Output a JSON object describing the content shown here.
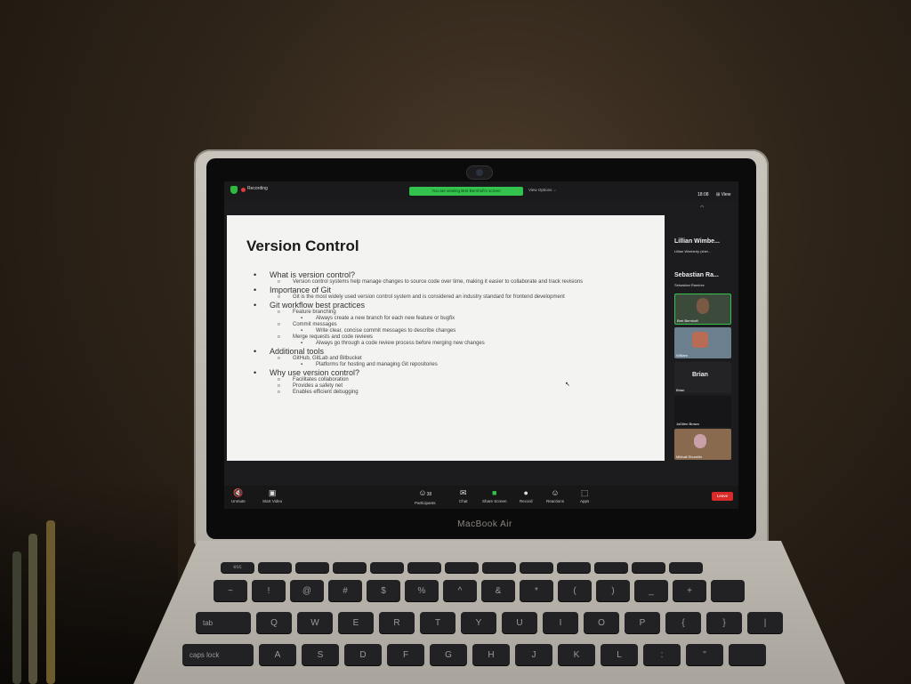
{
  "zoom": {
    "topbar": {
      "recording_label": "Recording",
      "viewing_banner": "You are viewing Bret Bernhoft's screen",
      "view_options": "View Options ⌵",
      "clock": "18:08",
      "view_button": "⊞ View"
    },
    "slide": {
      "title": "Version Control",
      "items": [
        {
          "level": 1,
          "text": "What is version control?"
        },
        {
          "level": 2,
          "text": "Version control systems help manage changes to source code over time, making it easier to collaborate and track revisions"
        },
        {
          "level": 1,
          "text": "Importance of Git"
        },
        {
          "level": 2,
          "text": "Git is the most widely used version control system and is considered an industry standard for frontend development"
        },
        {
          "level": 1,
          "text": "Git workflow best practices"
        },
        {
          "level": 2,
          "text": "Feature branching"
        },
        {
          "level": 3,
          "text": "Always create a new branch for each new feature or bugfix"
        },
        {
          "level": 2,
          "text": "Commit messages"
        },
        {
          "level": 3,
          "text": "Write clear, concise commit messages to describe changes"
        },
        {
          "level": 2,
          "text": "Merge requests and code reviews"
        },
        {
          "level": 3,
          "text": "Always go through a code review process before merging new changes"
        },
        {
          "level": 1,
          "text": "Additional tools"
        },
        {
          "level": 2,
          "text": "GitHub, GitLab and Bitbucket"
        },
        {
          "level": 3,
          "text": "Platforms for hosting and managing Git repositories"
        },
        {
          "level": 1,
          "text": "Why use version control?"
        },
        {
          "level": 2,
          "text": "Facilitates collaboration"
        },
        {
          "level": 2,
          "text": "Provides a safety net"
        },
        {
          "level": 2,
          "text": "Enables efficient debugging"
        }
      ]
    },
    "participants": {
      "name_tiles": [
        {
          "big": "Lillian Wimbe...",
          "small": "Lillian Wimberly (she/..."
        },
        {
          "big": "Sebastian Ra...",
          "small": "Sebastian Ramirez"
        }
      ],
      "video_tiles": [
        {
          "label": "Bret Bernhoft",
          "bg": "#3b4a3a",
          "active": true
        },
        {
          "label": "William",
          "bg": "#6b7f8e",
          "active": false
        }
      ],
      "brian_tile": {
        "big": "Brian",
        "small": "Brian"
      },
      "jodilen_tile": {
        "label": "JoDilen Brown"
      },
      "mikhail_tile": {
        "label": "Mikhail Shumilin"
      }
    },
    "toolbar": {
      "unmute": "Unmute",
      "start_video": "Start Video",
      "participants": "Participants",
      "participants_count": "38",
      "chat": "Chat",
      "share_screen": "Share Screen",
      "record": "Record",
      "reactions": "Reactions",
      "apps": "Apps",
      "leave": "Leave"
    },
    "colors": {
      "accent_green": "#33c24d",
      "leave_red": "#d92b2b"
    }
  },
  "laptop": {
    "brand": "MacBook Air",
    "keys": {
      "fn_row": [
        "esc",
        "",
        "",
        "",
        "",
        "",
        "",
        "",
        "",
        "",
        "",
        "",
        ""
      ],
      "num_row": [
        "~",
        "!",
        "@",
        "#",
        "$",
        "%",
        "^",
        "&",
        "*",
        "(",
        ")",
        "_",
        "+",
        ""
      ],
      "qwerty_row": [
        "tab",
        "Q",
        "W",
        "E",
        "R",
        "T",
        "Y",
        "U",
        "I",
        "O",
        "P",
        "{",
        "}",
        "|"
      ],
      "asdf_row": [
        "caps lock",
        "A",
        "S",
        "D",
        "F",
        "G",
        "H",
        "J",
        "K",
        "L",
        ":",
        "\"",
        ""
      ]
    }
  }
}
